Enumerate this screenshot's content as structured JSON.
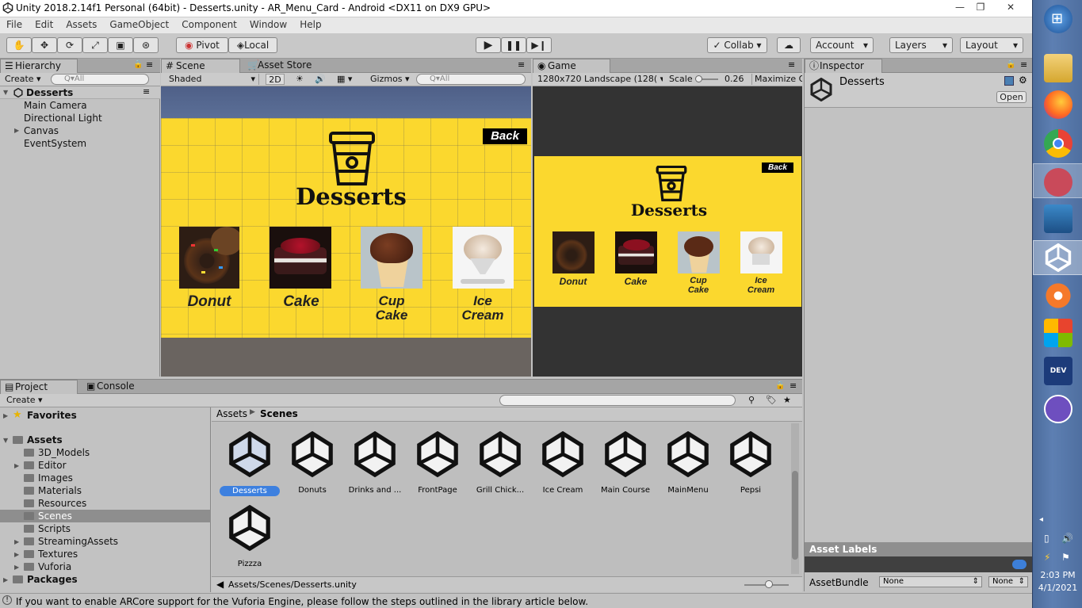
{
  "window": {
    "title": "Unity 2018.2.14f1 Personal (64bit) - Desserts.unity - AR_Menu_Card - Android <DX11 on DX9 GPU>"
  },
  "menu": [
    "File",
    "Edit",
    "Assets",
    "GameObject",
    "Component",
    "Window",
    "Help"
  ],
  "toolbar": {
    "pivot": "Pivot",
    "local": "Local",
    "collab": "Collab",
    "account": "Account",
    "layers": "Layers",
    "layout": "Layout"
  },
  "hierarchy": {
    "tab": "Hierarchy",
    "create": "Create",
    "search": "Q▾All",
    "root": "Desserts",
    "items": [
      "Main Camera",
      "Directional Light",
      "Canvas",
      "EventSystem"
    ]
  },
  "scene": {
    "tab": "Scene",
    "tab2": "Asset Store",
    "shading": "Shaded",
    "mode2d": "2D",
    "gizmos": "Gizmos",
    "search": "Q▾All"
  },
  "game": {
    "tab": "Game",
    "resolution": "1280x720 Landscape (128(",
    "scale_label": "Scale",
    "scale_value": "0.26",
    "maximize": "Maximize O"
  },
  "menu_card": {
    "back": "Back",
    "title": "Desserts",
    "items": [
      {
        "name": "Donut",
        "line2": ""
      },
      {
        "name": "Cake",
        "line2": ""
      },
      {
        "name": "Cup",
        "line2": "Cake"
      },
      {
        "name": "Ice",
        "line2": "Cream"
      }
    ]
  },
  "inspector": {
    "tab": "Inspector",
    "object": "Desserts",
    "open": "Open",
    "asset_labels": "Asset Labels",
    "assetbundle_label": "AssetBundle",
    "assetbundle_value": "None",
    "variant_value": "None"
  },
  "project": {
    "tab": "Project",
    "tab2": "Console",
    "create": "Create",
    "favorites": "Favorites",
    "assets": "Assets",
    "folders": [
      "3D_Models",
      "Editor",
      "Images",
      "Materials",
      "Resources",
      "Scenes",
      "Scripts",
      "StreamingAssets",
      "Textures",
      "Vuforia"
    ],
    "packages": "Packages",
    "breadcrumb_root": "Assets",
    "breadcrumb_current": "Scenes",
    "scenes": [
      "Desserts",
      "Donuts",
      "Drinks and ...",
      "FrontPage",
      "Grill Chick...",
      "Ice Cream",
      "Main Course",
      "MainMenu",
      "Pepsi",
      "Pizzza"
    ],
    "path": "Assets/Scenes/Desserts.unity"
  },
  "status": {
    "message": "If you want to enable ARCore support for the Vuforia Engine, please follow the steps outlined in the library article below."
  },
  "clock": {
    "time": "2:03 PM",
    "date": "4/1/2021"
  },
  "taskbar_icons": [
    "windows-start-icon",
    "file-explorer-icon",
    "firefox-icon",
    "chrome-icon",
    "snipping-tool-icon",
    "media-icon",
    "unity-icon",
    "blender-icon",
    "office-icon",
    "devcpp-icon",
    "github-desktop-icon"
  ],
  "colors": {
    "card_yellow": "#fbd82e",
    "panel_gray": "#c2c2c2",
    "game_dark": "#333333",
    "selection_blue": "#3d80df"
  }
}
